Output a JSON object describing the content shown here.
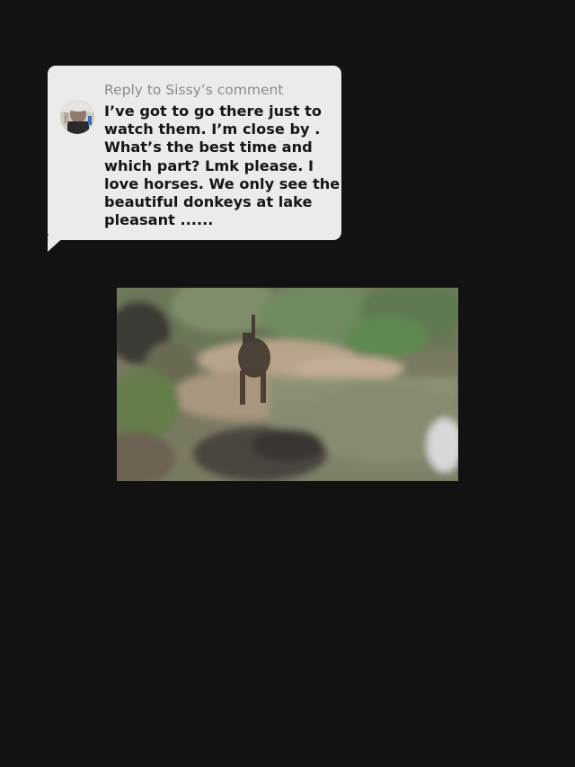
{
  "comment": {
    "reply_to": "Reply to Sissy’s comment",
    "lines": [
      "I’ve got to go there just to",
      "watch them. I’m close by .",
      "What’s the best time and",
      "which part? Lmk please. I",
      "love horses. We only see the",
      "beautiful donkeys at lake",
      "pleasant ......"
    ]
  },
  "colors": {
    "background": "#121212",
    "bubble": "#ebebeb",
    "reply_header": "#8a8a8a",
    "comment_text": "#161616"
  },
  "icons": {
    "avatar": "user-avatar-photo"
  }
}
